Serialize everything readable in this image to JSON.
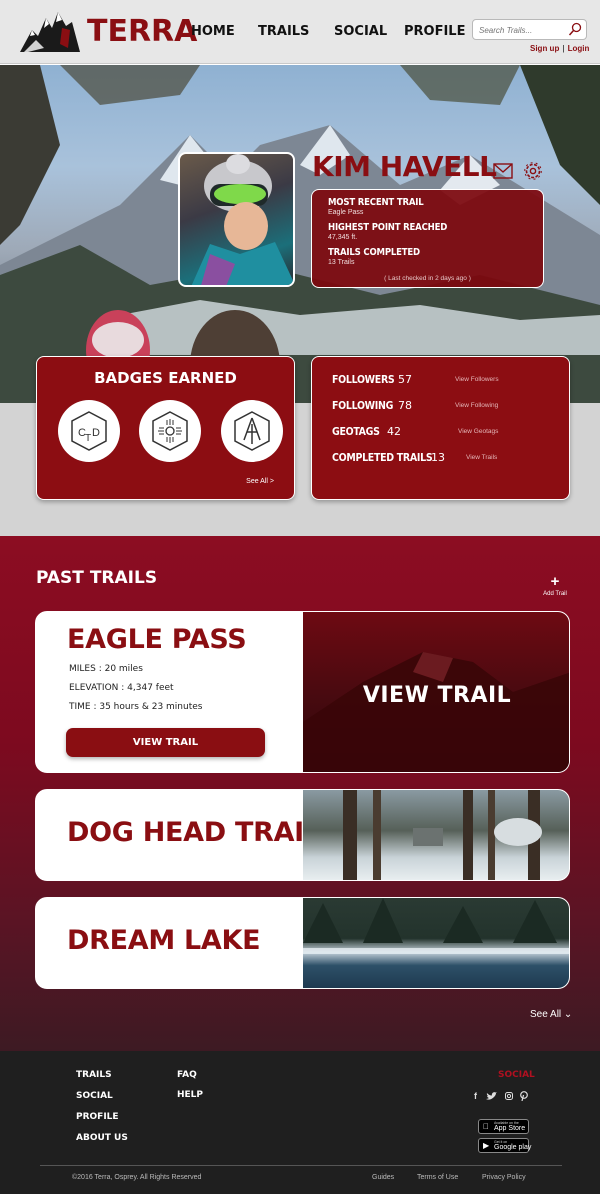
{
  "header": {
    "logo_text": "TERRA",
    "nav": [
      "HOME",
      "TRAILS",
      "SOCIAL",
      "PROFILE"
    ],
    "search_placeholder": "Search Trails...",
    "sign_up": "Sign up",
    "separator": "|",
    "login": "Login"
  },
  "profile": {
    "name": "KIM HAVELL",
    "stats": [
      {
        "title": "MOST RECENT TRAIL",
        "value": "Eagle Pass"
      },
      {
        "title": "HIGHEST POINT REACHED",
        "value": "47,345 ft."
      },
      {
        "title": "TRAILS COMPLETED",
        "value": "13 Trails"
      }
    ],
    "last_checked": "( Last checked in 2 days ago )"
  },
  "badges": {
    "title": "BADGES EARNED",
    "see_all": "See All >",
    "items": [
      "cdt-badge",
      "zia-badge",
      "at-badge"
    ]
  },
  "social": {
    "rows": [
      {
        "label": "FOLLOWERS",
        "count": "57",
        "link": "View Followers"
      },
      {
        "label": "FOLLOWING",
        "count": "78",
        "link": "View Following"
      },
      {
        "label": "GEOTAGS",
        "count": "42",
        "link": "View Geotags"
      },
      {
        "label": "COMPLETED TRAILS",
        "count": "13",
        "link": "View Trails"
      }
    ]
  },
  "past_trails": {
    "title": "PAST TRAILS",
    "add_label": "Add Trail",
    "add_icon": "+",
    "featured": {
      "name": "EAGLE PASS",
      "miles": "MILES : 20 miles",
      "elevation": "ELEVATION : 4,347 feet",
      "time": "TIME : 35 hours & 23 minutes",
      "button": "VIEW TRAIL",
      "overlay": "VIEW TRAIL"
    },
    "others": [
      {
        "name": "DOG HEAD TRAIL"
      },
      {
        "name": "DREAM LAKE"
      }
    ],
    "see_all": "See All ⌄"
  },
  "footer": {
    "col1": [
      "TRAILS",
      "SOCIAL",
      "PROFILE",
      "ABOUT US"
    ],
    "col2": [
      "FAQ",
      "HELP"
    ],
    "social_title": "SOCIAL",
    "social_icons": [
      "f",
      "🐦",
      "▣",
      "℘"
    ],
    "app_store_small": "Available on the",
    "app_store": "App Store",
    "google_small": "Get it on",
    "google": "Google play",
    "copyright": "©2016 Terra, Osprey. All Rights Reserved",
    "links": [
      "Guides",
      "Terms of Use",
      "Privacy Policy"
    ]
  },
  "colors": {
    "brand_red": "#8a0e12",
    "section_red": "#8c0d22",
    "footer_bg": "#1f1f1f"
  }
}
